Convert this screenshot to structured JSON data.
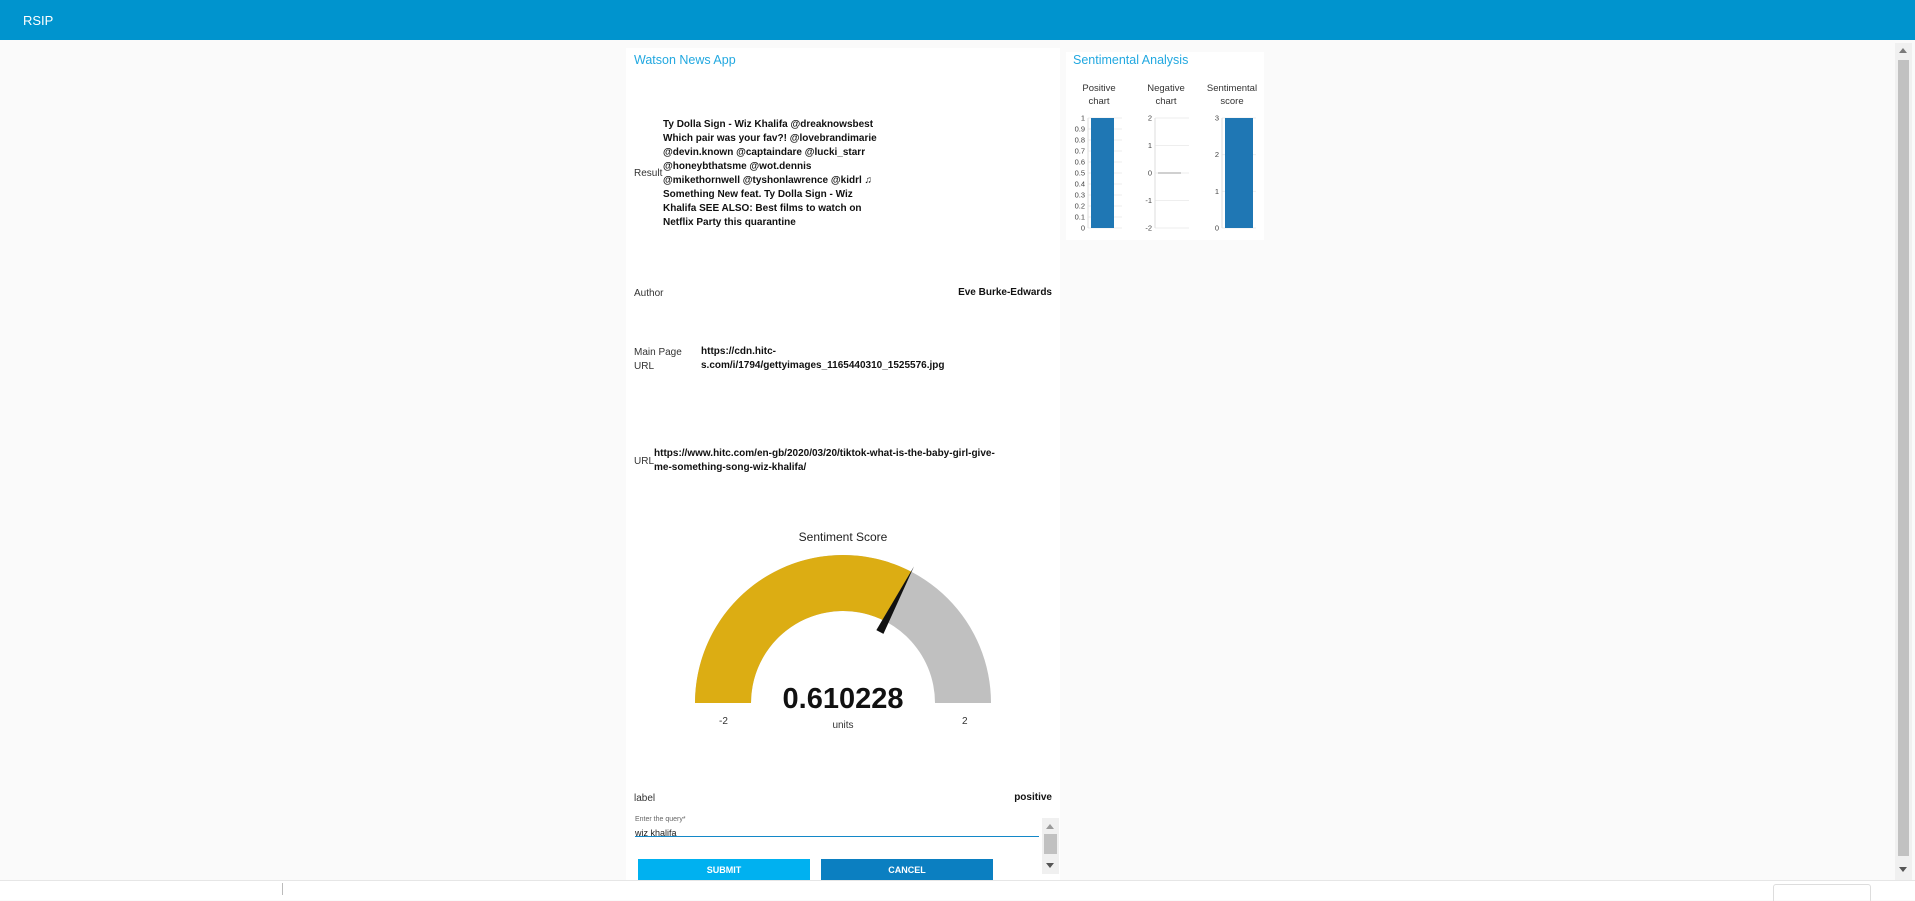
{
  "app": {
    "title": "RSIP"
  },
  "main": {
    "title": "Watson News App",
    "result_label": "Result",
    "result_lines": [
      "Ty Dolla Sign - Wiz Khalifa @dreaknowsbest",
      "Which pair was your fav?! @lovebrandimarie",
      "@devin.known @captaindare @lucki_starr",
      "@honeybthatsme @wot.dennis",
      "@mikethornwell @tyshonlawrence @kidrl ♫",
      "Something New feat. Ty Dolla Sign - Wiz",
      "Khalifa SEE ALSO: Best films to watch on",
      "Netflix Party this quarantine"
    ],
    "author_label": "Author",
    "author_value": "Eve Burke-Edwards",
    "main_page_url_label_1": "Main Page",
    "main_page_url_label_2": "URL",
    "main_page_url_line_1": "https://cdn.hitc-",
    "main_page_url_line_2": "s.com/i/1794/gettyimages_1165440310_1525576.jpg",
    "url_label": "URL",
    "url_line_1": "https://www.hitc.com/en-gb/2020/03/20/tiktok-what-is-the-baby-girl-give-",
    "url_line_2": "me-something-song-wiz-khalifa/",
    "gauge": {
      "title": "Sentiment Score",
      "value": 0.610228,
      "value_text": "0.610228",
      "units": "units",
      "min": -2,
      "max": 2,
      "min_text": "-2",
      "max_text": "2",
      "fill_color": "#dcad13",
      "track_color": "#c0c0c0"
    },
    "label_label": "label",
    "label_value": "positive",
    "query": {
      "label": "Enter the query",
      "required_mark": "*",
      "value": "wiz khalifa"
    },
    "submit_label": "SUBMIT",
    "cancel_label": "CANCEL",
    "colors": {
      "submit": "#00b1f0",
      "cancel": "#0b7fc1",
      "accent": "#22a8e0"
    }
  },
  "sidebar": {
    "title": "Sentimental Analysis",
    "chart_data": [
      {
        "type": "bar",
        "title_lines": [
          "Positive",
          "chart"
        ],
        "ylim": [
          0,
          1
        ],
        "ticks": [
          "1",
          "0.9",
          "0.8",
          "0.7",
          "0.6",
          "0.5",
          "0.4",
          "0.3",
          "0.2",
          "0.1",
          "0"
        ],
        "values": [
          1
        ],
        "color": "#1f77b4"
      },
      {
        "type": "bar",
        "title_lines": [
          "Negative",
          "chart"
        ],
        "ylim": [
          -2,
          2
        ],
        "ticks": [
          "2",
          "1",
          "0",
          "-1",
          "-2"
        ],
        "values": [
          0
        ],
        "color": "#1f77b4"
      },
      {
        "type": "bar",
        "title_lines": [
          "Sentimental",
          "score"
        ],
        "ylim": [
          0,
          3
        ],
        "ticks": [
          "3",
          "2",
          "1",
          "0"
        ],
        "values": [
          3
        ],
        "color": "#1f77b4"
      }
    ]
  }
}
